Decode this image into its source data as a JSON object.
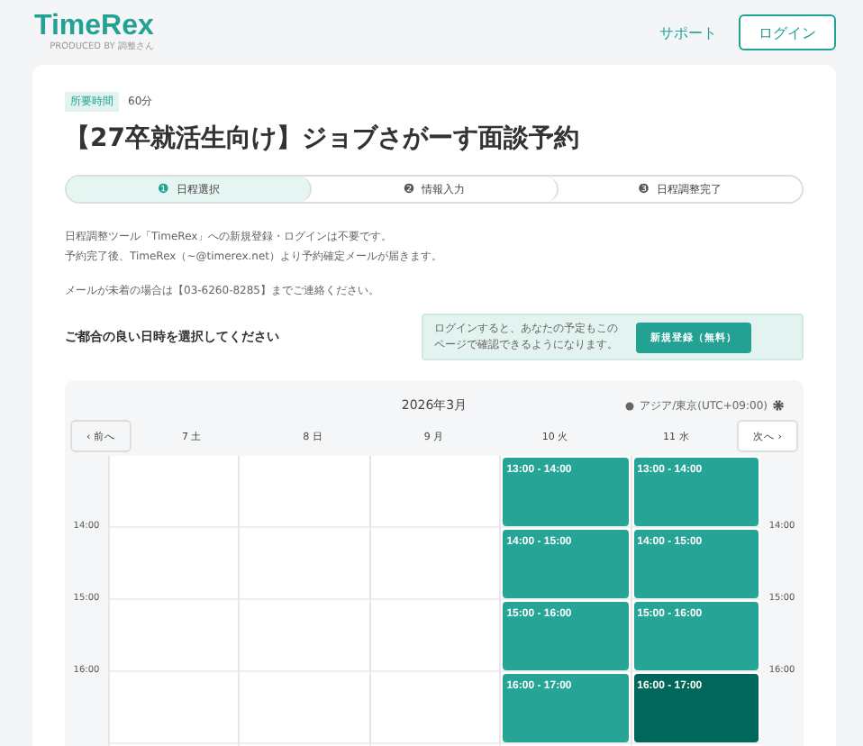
{
  "header": {
    "logo": "TimeRex",
    "logo_tagline": "PRODUCED BY 調整さん",
    "support_link": "サポート",
    "login_button": "ログイン"
  },
  "event": {
    "duration_label": "所要時間",
    "duration": "60分",
    "title": "【27卒就活生向け】ジョブさがーす面談予約"
  },
  "steps": [
    {
      "number": "❶",
      "label": "日程選択",
      "selected": true
    },
    {
      "number": "❷",
      "label": "情報入力",
      "selected": false
    },
    {
      "number": "❸",
      "label": "日程調整完了",
      "selected": false
    }
  ],
  "notes": [
    "日程調整ツール「TimeRex」への新規登録・ログインは不要です。",
    "予約完了後、TimeRex（~@timerex.net）より予約確定メールが届きます。",
    "メールが未着の場合は【03-6260-8285】までご連絡ください。"
  ],
  "prompt": "ご都合の良い日時を選択してください",
  "login_hint": {
    "text": "ログインすると、あなたの予定もこのページで確認できるようになります。",
    "button": "新規登録（無料）"
  },
  "calendar": {
    "month": "2026年3月",
    "timezone": "アジア/東京(UTC+09:00)",
    "prev_button": "‹ 前へ",
    "next_button": "次へ ›",
    "time_labels_left": [
      "14:00",
      "15:00",
      "16:00"
    ],
    "time_labels_right": [
      "14:00",
      "15:00",
      "16:00"
    ],
    "days": [
      {
        "label": "7 土"
      },
      {
        "label": "8 日"
      },
      {
        "label": "9 月"
      },
      {
        "label": "10 火",
        "slots": [
          {
            "time": "13:00 - 14:00",
            "selected": false
          },
          {
            "time": "14:00 - 15:00",
            "selected": false
          },
          {
            "time": "15:00 - 16:00",
            "selected": false
          },
          {
            "time": "16:00 - 17:00",
            "selected": false
          }
        ]
      },
      {
        "label": "11 水",
        "slots": [
          {
            "time": "13:00 - 14:00",
            "selected": false
          },
          {
            "time": "14:00 - 15:00",
            "selected": false
          },
          {
            "time": "15:00 - 16:00",
            "selected": false
          },
          {
            "time": "16:00 - 17:00",
            "selected": true
          }
        ]
      }
    ]
  }
}
